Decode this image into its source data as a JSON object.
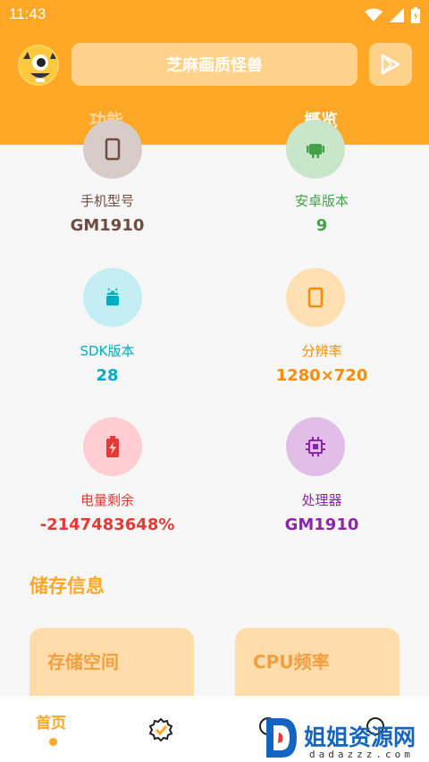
{
  "status_bar": {
    "time": "11:43"
  },
  "header": {
    "app_title": "芝麻画质怪兽",
    "tabs": [
      {
        "label": "功能",
        "active": false
      },
      {
        "label": "概览",
        "active": true
      }
    ]
  },
  "info_items": [
    {
      "label": "手机型号",
      "value": "GM1910",
      "icon": "phone-icon",
      "label_color": "#6d4c41",
      "value_color": "#6d4c41",
      "bg_color": "#d7ccc8"
    },
    {
      "label": "安卓版本",
      "value": "9",
      "icon": "android-icon",
      "label_color": "#43a047",
      "value_color": "#43a047",
      "bg_color": "#c8e6c9"
    },
    {
      "label": "SDK版本",
      "value": "28",
      "icon": "android-icon",
      "label_color": "#00acc1",
      "value_color": "#00acc1",
      "bg_color": "#c5eef4"
    },
    {
      "label": "分辨率",
      "value": "1280×720",
      "icon": "screen-icon",
      "label_color": "#fb8c00",
      "value_color": "#fb8c00",
      "bg_color": "#ffe0b2"
    },
    {
      "label": "电量剩余",
      "value": "-2147483648%",
      "icon": "battery-icon",
      "label_color": "#e53935",
      "value_color": "#e53935",
      "bg_color": "#ffcdd2"
    },
    {
      "label": "处理器",
      "value": "GM1910",
      "icon": "cpu-icon",
      "label_color": "#8e24aa",
      "value_color": "#8e24aa",
      "bg_color": "#e1bee7"
    }
  ],
  "storage_section": {
    "title": "储存信息",
    "cards": [
      {
        "label": "存储空间"
      },
      {
        "label": "CPU频率"
      }
    ]
  },
  "bottom_nav": {
    "home_label": "首页"
  },
  "watermark": {
    "text": "姐姐资源网",
    "sub": "dadazzz.com"
  },
  "colors": {
    "primary": "#ffa726"
  }
}
